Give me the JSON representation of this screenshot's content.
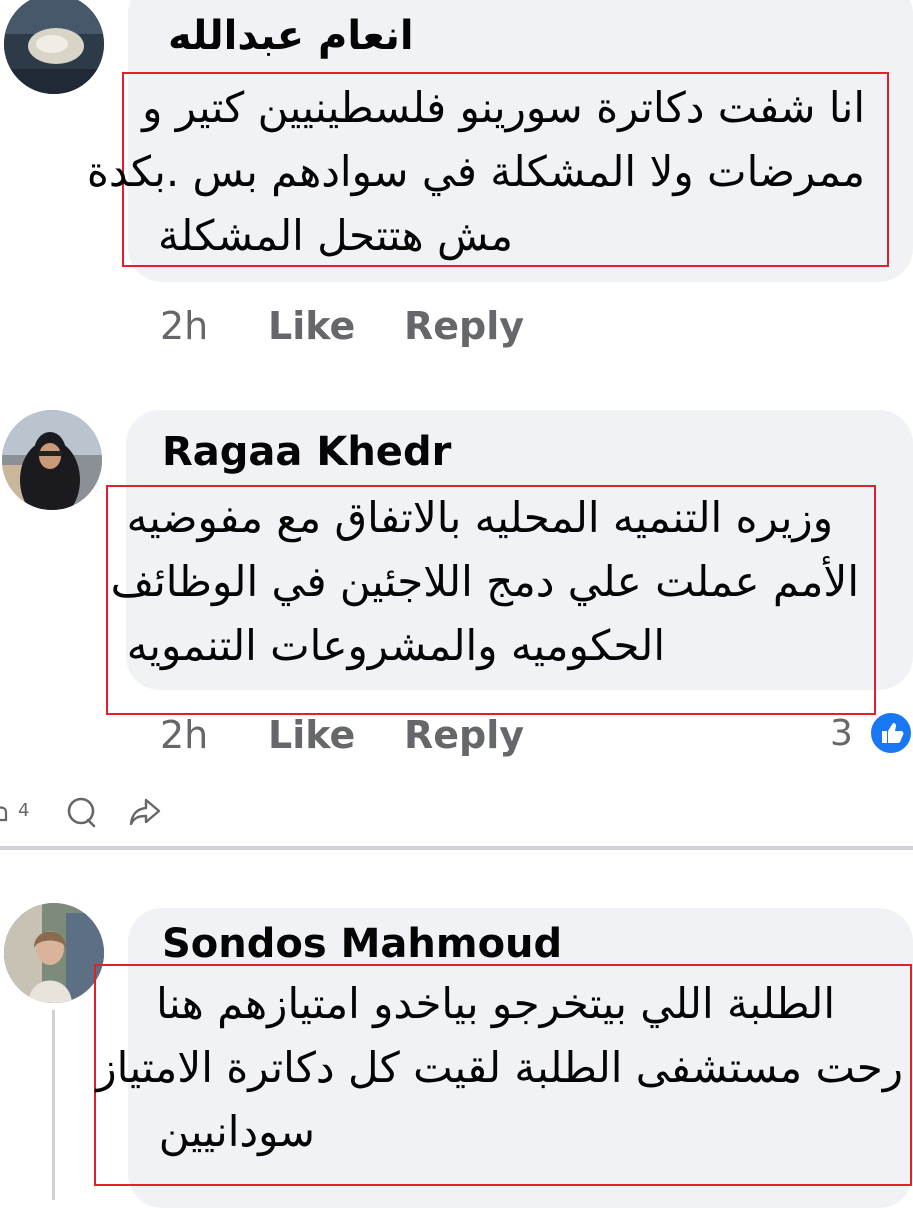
{
  "comments": [
    {
      "author": "انعام عبدالله",
      "lines": [
        "انا شفت دكاترة سورينو فلسطينيين كتير و",
        "ممرضات ولا المشكلة في سوادهم بس .بكدة",
        "مش هتتحل المشكلة"
      ],
      "time": "2h",
      "like_label": "Like",
      "reply_label": "Reply"
    },
    {
      "author": "Ragaa Khedr",
      "lines": [
        "وزيره التنميه المحليه بالاتفاق مع مفوضيه",
        "الأمم عملت علي دمج اللاجئين في الوظائف",
        "الحكوميه والمشروعات التنمويه"
      ],
      "time": "2h",
      "like_label": "Like",
      "reply_label": "Reply",
      "reaction_count": "3"
    },
    {
      "author": "Sondos Mahmoud",
      "lines": [
        "الطلبة اللي بيتخرجو بياخدو امتيازهم هنا",
        "رحت مستشفى الطلبة لقيت كل دكاترة الامتياز",
        "سودانيين"
      ]
    }
  ],
  "post_actions": {
    "reaction_count": "4"
  },
  "colors": {
    "highlight_border": "#e0202a",
    "bubble_bg": "#f0f2f5",
    "meta_text": "#65676b",
    "like_blue": "#1877f2"
  },
  "icons": [
    "reaction-icon",
    "comment-icon",
    "share-icon",
    "like-reaction-icon"
  ]
}
